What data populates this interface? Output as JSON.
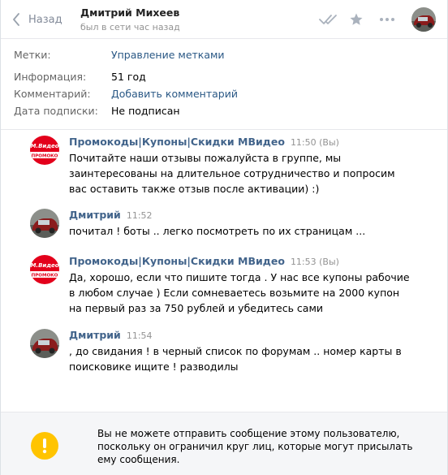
{
  "header": {
    "back_label": "Назад",
    "peer_name": "Дмитрий Михеев",
    "peer_status": "был в сети час назад",
    "icons": [
      "read-check-icon",
      "star-icon",
      "more-icon"
    ]
  },
  "details": {
    "rows": [
      {
        "label": "Метки:",
        "value": "Управление метками",
        "link": true
      },
      {
        "label": "Информация:",
        "value": "51 год",
        "link": false
      },
      {
        "label": "Комментарий:",
        "value": "Добавить комментарий",
        "link": true
      },
      {
        "label": "Дата подписки:",
        "value": "Не подписан",
        "link": false
      }
    ]
  },
  "messages": [
    {
      "author": "Промокоды|Купоны|Скидки МВидео",
      "time": "11:50 (Вы)",
      "text": "Почитайте наши отзывы пожалуйста в группе, мы\nзаинтересованы на длительное сотрудничество и попросим\nвас оставить также отзыв после активации) :)",
      "avatar": "mvideo"
    },
    {
      "author": "Дмитрий",
      "time": "11:52",
      "text": "почитал ! боты .. легко посмотреть по их страницам ...",
      "avatar": "car"
    },
    {
      "author": "Промокоды|Купоны|Скидки МВидео",
      "time": "11:53 (Вы)",
      "text": "Да, хорошо, если что пишите тогда . У нас все купоны рабочие\nв любом случае ) Если сомневаетесь возьмите на 2000 купон\nна первый раз за 750 рублей и убедитесь сами",
      "avatar": "mvideo"
    },
    {
      "author": "Дмитрий",
      "time": "11:54",
      "text": ", до свидания ! в черный список по форумам .. номер карты в\nпоисковике ищите ! разводилы",
      "avatar": "car"
    }
  ],
  "avatar_text": {
    "mvideo_top": "М.Видео",
    "mvideo_bottom": "ПРОМОКО"
  },
  "footer": {
    "warning_text": "Вы не можете отправить сообщение этому пользователю,\nпоскольку он ограничил круг лиц, которые могут присылать\nему сообщения.",
    "warning_icon": "exclamation-icon"
  },
  "colors": {
    "link": "#2a5885",
    "author": "#42648b",
    "muted": "#939393",
    "warning": "#ffc400",
    "mvideo_red": "#e3001b"
  }
}
